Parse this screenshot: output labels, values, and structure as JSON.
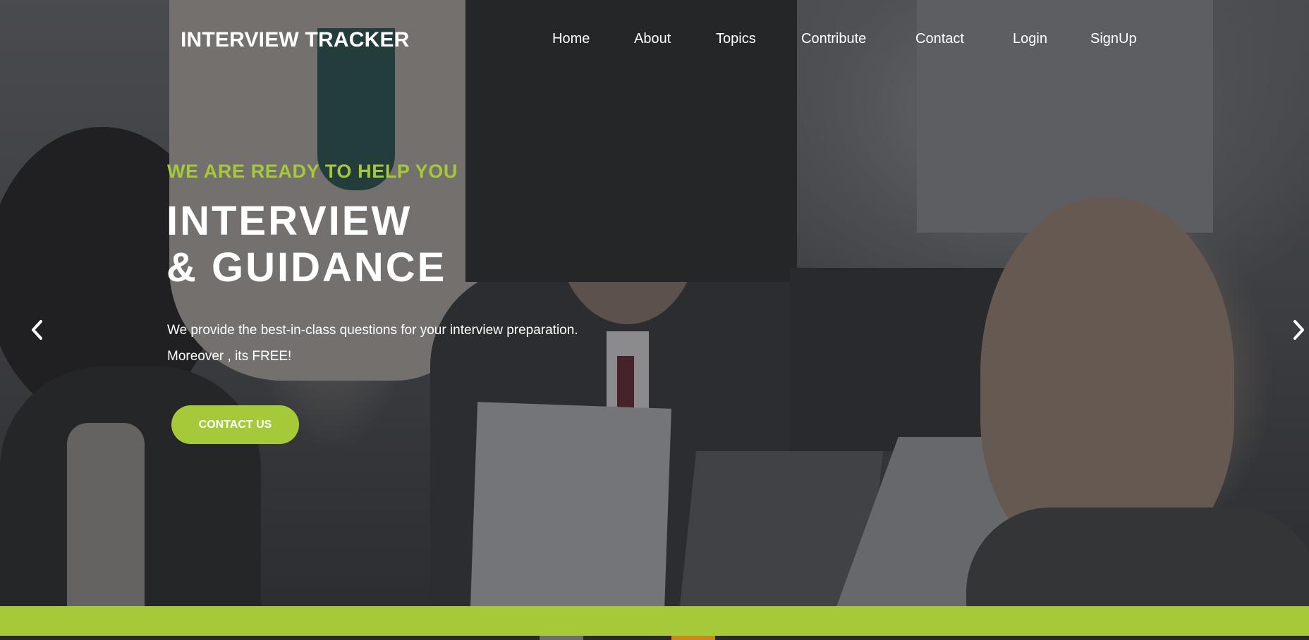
{
  "brand": {
    "name": "INTERVIEW TRACKER"
  },
  "nav": {
    "items": [
      {
        "label": "Home"
      },
      {
        "label": "About"
      },
      {
        "label": "Topics"
      },
      {
        "label": "Contribute"
      },
      {
        "label": "Contact"
      },
      {
        "label": "Login"
      },
      {
        "label": "SignUp"
      }
    ]
  },
  "hero": {
    "tagline": "WE ARE READY TO HELP YOU",
    "title_line1": "INTERVIEW",
    "title_line2": "& GUIDANCE",
    "description_line1": "We provide the best-in-class questions for your interview preparation.",
    "description_line2": "Moreover , its FREE!",
    "cta_label": "CONTACT US"
  },
  "carousel": {
    "prev_icon": "chevron-left-icon",
    "next_icon": "chevron-right-icon"
  },
  "colors": {
    "accent": "#a6c93a",
    "text": "#ffffff"
  }
}
